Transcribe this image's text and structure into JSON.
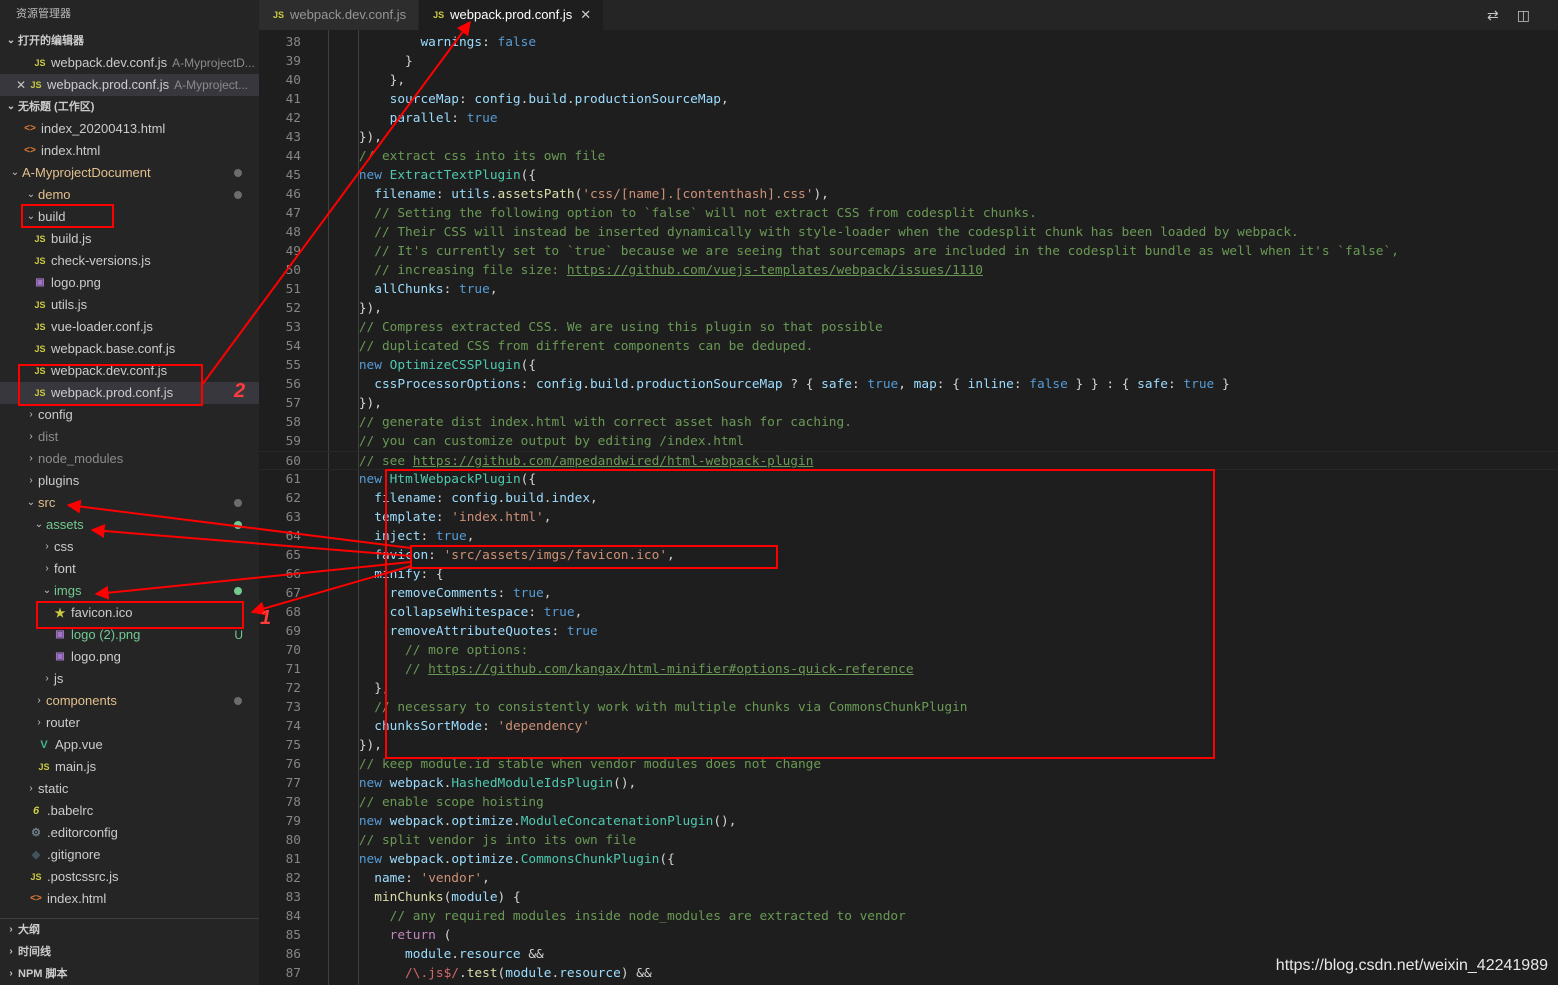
{
  "sidebar": {
    "title": "资源管理器",
    "open_editors": {
      "header": "打开的编辑器",
      "items": [
        {
          "name": "webpack.dev.conf.js",
          "desc": "A-MyprojectD..."
        },
        {
          "name": "webpack.prod.conf.js",
          "desc": "A-Myproject..."
        }
      ]
    },
    "workspace_header": "无标题 (工作区)",
    "tree": [
      {
        "label": "index_20200413.html",
        "icon": "html-icon",
        "depth": 0
      },
      {
        "label": "index.html",
        "icon": "html-icon",
        "depth": 0
      },
      {
        "label": "A-MyprojectDocument",
        "icon": "folder-open",
        "depth": 0
      },
      {
        "label": "demo",
        "icon": "folder-open",
        "depth": 1
      },
      {
        "label": "build",
        "icon": "folder-open",
        "depth": 1
      },
      {
        "label": "build.js",
        "icon": "js-icon",
        "depth": 2
      },
      {
        "label": "check-versions.js",
        "icon": "js-icon",
        "depth": 2
      },
      {
        "label": "logo.png",
        "icon": "image-icon",
        "depth": 2
      },
      {
        "label": "utils.js",
        "icon": "js-icon",
        "depth": 2
      },
      {
        "label": "vue-loader.conf.js",
        "icon": "js-icon",
        "depth": 2
      },
      {
        "label": "webpack.base.conf.js",
        "icon": "js-icon",
        "depth": 2
      },
      {
        "label": "webpack.dev.conf.js",
        "icon": "js-icon",
        "depth": 2
      },
      {
        "label": "webpack.prod.conf.js",
        "icon": "js-icon",
        "depth": 2
      },
      {
        "label": "config",
        "icon": "folder-closed",
        "depth": 1
      },
      {
        "label": "dist",
        "icon": "folder-closed",
        "depth": 1
      },
      {
        "label": "node_modules",
        "icon": "folder-closed",
        "depth": 1
      },
      {
        "label": "plugins",
        "icon": "folder-closed",
        "depth": 1
      },
      {
        "label": "src",
        "icon": "folder-open",
        "depth": 1
      },
      {
        "label": "assets",
        "icon": "folder-open",
        "depth": 2
      },
      {
        "label": "css",
        "icon": "folder-closed",
        "depth": 3
      },
      {
        "label": "font",
        "icon": "folder-closed",
        "depth": 3
      },
      {
        "label": "imgs",
        "icon": "folder-open",
        "depth": 3
      },
      {
        "label": "favicon.ico",
        "icon": "star-icon",
        "depth": 4
      },
      {
        "label": "logo (2).png",
        "icon": "image-icon",
        "depth": 4,
        "status": "U"
      },
      {
        "label": "logo.png",
        "icon": "image-icon",
        "depth": 4
      },
      {
        "label": "js",
        "icon": "folder-closed",
        "depth": 3
      },
      {
        "label": "components",
        "icon": "folder-closed",
        "depth": 2
      },
      {
        "label": "router",
        "icon": "folder-closed",
        "depth": 2
      },
      {
        "label": "App.vue",
        "icon": "vue-icon",
        "depth": 2
      },
      {
        "label": "main.js",
        "icon": "js-icon",
        "depth": 2
      },
      {
        "label": "static",
        "icon": "folder-closed",
        "depth": 1
      },
      {
        "label": ".babelrc",
        "icon": "babel-icon",
        "depth": 1
      },
      {
        "label": ".editorconfig",
        "icon": "gear-icon",
        "depth": 1
      },
      {
        "label": ".gitignore",
        "icon": "git-icon",
        "depth": 1
      },
      {
        "label": ".postcssrc.js",
        "icon": "js-icon",
        "depth": 1
      },
      {
        "label": "index.html",
        "icon": "html-icon",
        "depth": 1
      }
    ],
    "bottom_sections": [
      "大纲",
      "时间线",
      "NPM 脚本"
    ]
  },
  "tabs": [
    {
      "label": "webpack.dev.conf.js",
      "active": false
    },
    {
      "label": "webpack.prod.conf.js",
      "active": true
    }
  ],
  "tab_actions": [
    "source-control-compare-icon",
    "split-editor-icon"
  ],
  "editor": {
    "first_line": 38,
    "lines": [
      "            warnings: false",
      "          }",
      "        },",
      "        sourceMap: config.build.productionSourceMap,",
      "        parallel: true",
      "    }),",
      "    // extract css into its own file",
      "    new ExtractTextPlugin({",
      "      filename: utils.assetsPath('css/[name].[contenthash].css'),",
      "      // Setting the following option to `false` will not extract CSS from codesplit chunks.",
      "      // Their CSS will instead be inserted dynamically with style-loader when the codesplit chunk has been loaded by webpack.",
      "      // It's currently set to `true` because we are seeing that sourcemaps are included in the codesplit bundle as well when it's `false`,",
      "      // increasing file size: https://github.com/vuejs-templates/webpack/issues/1110",
      "      allChunks: true,",
      "    }),",
      "    // Compress extracted CSS. We are using this plugin so that possible",
      "    // duplicated CSS from different components can be deduped.",
      "    new OptimizeCSSPlugin({",
      "      cssProcessorOptions: config.build.productionSourceMap ? { safe: true, map: { inline: false } } : { safe: true }",
      "    }),",
      "    // generate dist index.html with correct asset hash for caching.",
      "    // you can customize output by editing /index.html",
      "    // see https://github.com/ampedandwired/html-webpack-plugin",
      "    new HtmlWebpackPlugin({",
      "      filename: config.build.index,",
      "      template: 'index.html',",
      "      inject: true,",
      "      favicon: 'src/assets/imgs/favicon.ico',",
      "      minify: {",
      "        removeComments: true,",
      "        collapseWhitespace: true,",
      "        removeAttributeQuotes: true",
      "          // more options:",
      "          // https://github.com/kangax/html-minifier#options-quick-reference",
      "      },",
      "      // necessary to consistently work with multiple chunks via CommonsChunkPlugin",
      "      chunksSortMode: 'dependency'",
      "    }),",
      "    // keep module.id stable when vendor modules does not change",
      "    new webpack.HashedModuleIdsPlugin(),",
      "    // enable scope hoisting",
      "    new webpack.optimize.ModuleConcatenationPlugin(),",
      "    // split vendor js into its own file",
      "    new webpack.optimize.CommonsChunkPlugin({",
      "      name: 'vendor',",
      "      minChunks(module) {",
      "        // any required modules inside node_modules are extracted to vendor",
      "        return (",
      "          module.resource &&",
      "          /\\.js$/.test(module.resource) &&"
    ]
  },
  "annotations": {
    "labels": [
      "2",
      "1"
    ],
    "color": "#ff0000"
  },
  "watermark": "https://blog.csdn.net/weixin_42241989"
}
